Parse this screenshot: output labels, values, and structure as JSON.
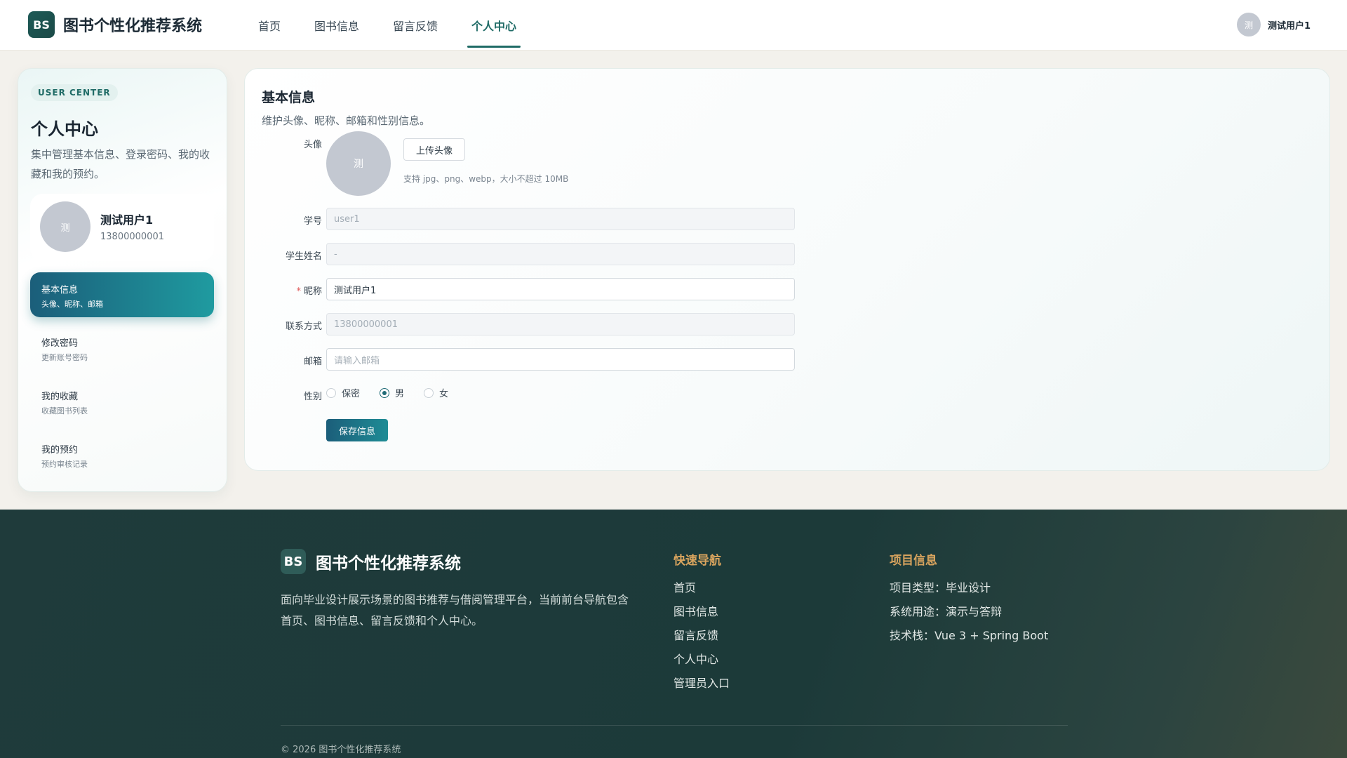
{
  "header": {
    "logo_text": "BS",
    "title": "图书个性化推荐系统",
    "nav": [
      "首页",
      "图书信息",
      "留言反馈",
      "个人中心"
    ],
    "active_nav": "个人中心",
    "user_avatar_text": "测",
    "user_name": "测试用户1"
  },
  "sidebar": {
    "badge": "USER CENTER",
    "title": "个人中心",
    "description": "集中管理基本信息、登录密码、我的收藏和我的预约。",
    "profile": {
      "avatar_text": "测",
      "name": "测试用户1",
      "phone": "13800000001"
    },
    "menu": [
      {
        "label": "基本信息",
        "sub": "头像、昵称、邮箱",
        "active": true
      },
      {
        "label": "修改密码",
        "sub": "更新账号密码",
        "active": false
      },
      {
        "label": "我的收藏",
        "sub": "收藏图书列表",
        "active": false
      },
      {
        "label": "我的预约",
        "sub": "预约审核记录",
        "active": false
      }
    ]
  },
  "form": {
    "title": "基本信息",
    "subtitle": "维护头像、昵称、邮箱和性别信息。",
    "avatar_label": "头像",
    "avatar_text": "测",
    "upload_button": "上传头像",
    "upload_hint": "支持 jpg、png、webp，大小不超过 10MB",
    "student_id_label": "学号",
    "student_id_value": "user1",
    "student_name_label": "学生姓名",
    "student_name_value": "-",
    "nickname_label": "昵称",
    "nickname_required_mark": "*",
    "nickname_value": "测试用户1",
    "contact_label": "联系方式",
    "contact_value": "13800000001",
    "email_label": "邮箱",
    "email_placeholder": "请输入邮箱",
    "gender_label": "性别",
    "gender_options": [
      "保密",
      "男",
      "女"
    ],
    "gender_selected": "男",
    "save_button": "保存信息"
  },
  "footer": {
    "logo_text": "BS",
    "title": "图书个性化推荐系统",
    "description": "面向毕业设计展示场景的图书推荐与借阅管理平台，当前前台导航包含首页、图书信息、留言反馈和个人中心。",
    "quick_nav_title": "快速导航",
    "quick_nav": [
      "首页",
      "图书信息",
      "留言反馈",
      "个人中心",
      "管理员入口"
    ],
    "project_title": "项目信息",
    "project_info": [
      "项目类型：毕业设计",
      "系统用途：演示与答辩",
      "技术栈：Vue 3 + Spring Boot"
    ],
    "copyright": "© 2026 图书个性化推荐系统"
  },
  "colors": {
    "primary": "#1f6b66",
    "active_gradient_start": "#1b5e7a",
    "active_gradient_end": "#1f9ba0",
    "footer_bg": "#1f3b3b",
    "footer_accent": "#d9a45e"
  }
}
